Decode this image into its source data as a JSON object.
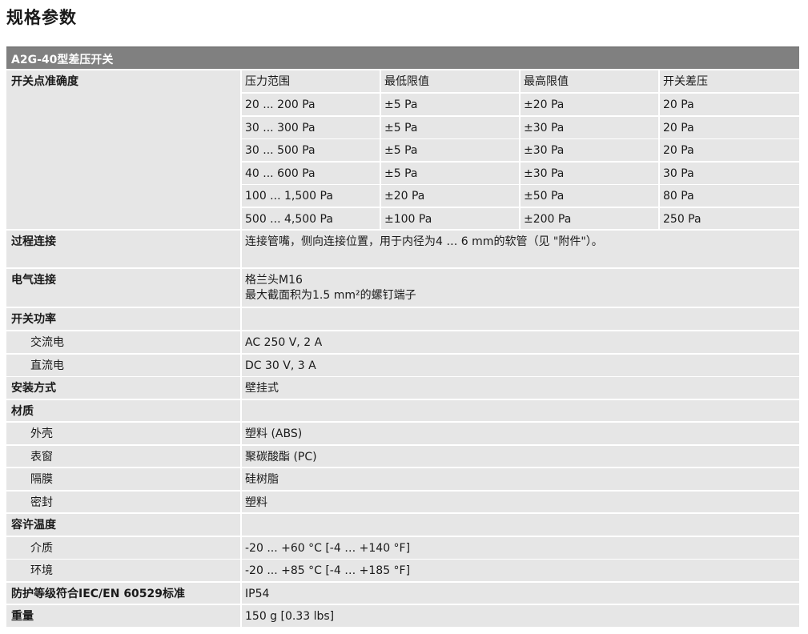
{
  "page_title": "规格参数",
  "table_title": "A2G-40型差压开关",
  "accuracy": {
    "label": "开关点准确度",
    "headers": [
      "压力范围",
      "最低限值",
      "最高限值",
      "开关差压"
    ],
    "rows": [
      [
        "20 ... 200 Pa",
        "±5 Pa",
        "±20 Pa",
        "20 Pa"
      ],
      [
        "30 ... 300 Pa",
        "±5 Pa",
        "±30 Pa",
        "20 Pa"
      ],
      [
        "30 ... 500 Pa",
        "±5 Pa",
        "±30 Pa",
        "20 Pa"
      ],
      [
        "40 ... 600 Pa",
        "±5 Pa",
        "±30 Pa",
        "30 Pa"
      ],
      [
        "100 ... 1,500 Pa",
        "±20 Pa",
        "±50 Pa",
        "80 Pa"
      ],
      [
        "500 ... 4,500 Pa",
        "±100 Pa",
        "±200 Pa",
        "250 Pa"
      ]
    ]
  },
  "process": {
    "label": "过程连接",
    "value": "连接管嘴，侧向连接位置，用于内径为4 … 6 mm的软管（见 \"附件\"）。"
  },
  "electrical": {
    "label": "电气连接",
    "line1": "格兰头M16",
    "line2": "最大截面积为1.5 mm²的螺钉端子"
  },
  "switching_power": {
    "label": "开关功率",
    "ac_label": "交流电",
    "ac_value": "AC 250 V, 2 A",
    "dc_label": "直流电",
    "dc_value": "DC 30 V, 3 A"
  },
  "mounting": {
    "label": "安装方式",
    "value": "壁挂式"
  },
  "material": {
    "label": "材质",
    "housing_label": "外壳",
    "housing_value": "塑料 (ABS)",
    "window_label": "表窗",
    "window_value": "聚碳酸酯 (PC)",
    "diaphragm_label": "隔膜",
    "diaphragm_value": "硅树脂",
    "seal_label": "密封",
    "seal_value": "塑料"
  },
  "temperature": {
    "label": "容许温度",
    "medium_label": "介质",
    "medium_value": "-20 ... +60 °C [-4 … +140 °F]",
    "ambient_label": "环境",
    "ambient_value": "-20 ... +85 °C [-4 … +185 °F]"
  },
  "protection": {
    "label": "防护等级符合IEC/EN 60529标准",
    "value": "IP54"
  },
  "weight": {
    "label": "重量",
    "value": "150 g [0.33 lbs]"
  }
}
